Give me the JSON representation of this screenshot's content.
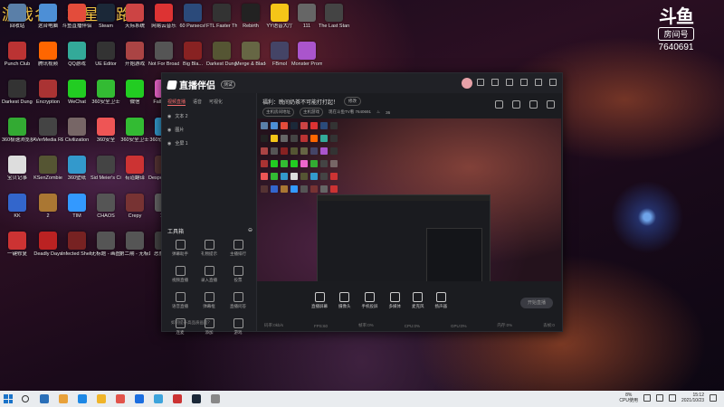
{
  "overlay_title": "游戏名：救星之路",
  "logo": {
    "mark": "斗鱼",
    "sub": "房间号",
    "room": "7640691"
  },
  "desktop_icons": [
    {
      "label": "回收站",
      "color": "#5a7fa8"
    },
    {
      "label": "这台电脑",
      "color": "#4d8fd6"
    },
    {
      "label": "斗鱼直播伴侣",
      "color": "#e34c3b"
    },
    {
      "label": "Steam",
      "color": "#1b2838"
    },
    {
      "label": "天际系统",
      "color": "#c44"
    },
    {
      "label": "网易云音乐",
      "color": "#d33"
    },
    {
      "label": "60 Parsecs!",
      "color": "#2b4a7a"
    },
    {
      "label": "FTL Faster Than Light",
      "color": "#333"
    },
    {
      "label": "Rebirth",
      "color": "#222"
    },
    {
      "label": "YY语音大厅",
      "color": "#f5c518"
    },
    {
      "label": "111",
      "color": "#666"
    },
    {
      "label": "The Last Stand A...",
      "color": "#444"
    },
    {
      "label": "Punch Club",
      "color": "#b33"
    },
    {
      "label": "腾讯视频",
      "color": "#f60"
    },
    {
      "label": "QQ游戏",
      "color": "#3a9"
    },
    {
      "label": "UE Editor",
      "color": "#333"
    },
    {
      "label": "开始游戏",
      "color": "#a44"
    },
    {
      "label": "Not For Broadcast",
      "color": "#555"
    },
    {
      "label": "Big Bla...",
      "color": "#822"
    },
    {
      "label": "Darkest Dungeon",
      "color": "#553"
    },
    {
      "label": "Merge & Blade",
      "color": "#664"
    },
    {
      "label": "FBmol",
      "color": "#446"
    },
    {
      "label": "Monster Prom",
      "color": "#a5c"
    },
    {
      "label": "Darkest Dungeon 2",
      "color": "#333"
    },
    {
      "label": "Encryption",
      "color": "#a33"
    },
    {
      "label": "WeChat",
      "color": "#2c2"
    },
    {
      "label": "360安全卫士",
      "color": "#3b3"
    },
    {
      "label": "微信",
      "color": "#2c2"
    },
    {
      "label": "Fall Guys",
      "color": "#e6c"
    },
    {
      "label": "360极速浏览器",
      "color": "#3a3"
    },
    {
      "label": "AVerMedia RECentral 4",
      "color": "#444"
    },
    {
      "label": "Civilization",
      "color": "#766"
    },
    {
      "label": "360安全",
      "color": "#e55"
    },
    {
      "label": "360安全卫士",
      "color": "#3b3"
    },
    {
      "label": "360软件管家",
      "color": "#39c"
    },
    {
      "label": "宝贝记事",
      "color": "#ddd"
    },
    {
      "label": "KSenZombie",
      "color": "#553"
    },
    {
      "label": "360壁纸",
      "color": "#39c"
    },
    {
      "label": "Sid Meier's Civilization",
      "color": "#444"
    },
    {
      "label": "有道翻译",
      "color": "#c33"
    },
    {
      "label": "Despot's Game",
      "color": "#533"
    },
    {
      "label": "KK",
      "color": "#36c"
    },
    {
      "label": "2",
      "color": "#a73"
    },
    {
      "label": "TIM",
      "color": "#39f"
    },
    {
      "label": "CHAOS",
      "color": "#555"
    },
    {
      "label": "Crepy",
      "color": "#733"
    },
    {
      "label": "111",
      "color": "#666"
    },
    {
      "label": "一键修复",
      "color": "#c33"
    },
    {
      "label": "Deadly Days",
      "color": "#b22"
    },
    {
      "label": "Infected Shelter",
      "color": "#722"
    },
    {
      "label": "无标题 - 画图",
      "color": "#555"
    },
    {
      "label": "第二期 - 无标题",
      "color": "#555"
    },
    {
      "label": "恶魔之路",
      "color": "#444"
    }
  ],
  "app": {
    "name": "直播伴侣",
    "version_badge": "测试",
    "tabs": [
      "视频直播",
      "语音",
      "可视化"
    ],
    "scenes": [
      "文本 2",
      "图片",
      "全屏 1"
    ],
    "announcement": "福利：晚间奶茶不可能打打起！",
    "announce_button": "修改",
    "room_label": "主机房间地址",
    "room_type": "主机游戏",
    "room_sub": "现在斗鱼TV看 7640691",
    "viewers": "36",
    "tools_title": "工具箱",
    "tools": [
      "弹幕助手",
      "礼物提示",
      "主播排行",
      "视频直播",
      "录入直播",
      "投票",
      "语音直播",
      "弹幕框",
      "直播问答",
      "连麦",
      "添加",
      "游戏"
    ],
    "controls": [
      "直播屏幕",
      "摄像头",
      "手机投屏",
      "多媒体",
      "麦克风",
      "扬声器"
    ],
    "start_button": "开始直播",
    "footer_left": "如何提升高品质画面？",
    "status": [
      "码率:0kb/s",
      "FPS:60",
      "帧率:0%",
      "CPU:0%",
      "GPU:0%",
      "内存:0%",
      "丢帧:0"
    ]
  },
  "taskbar": {
    "apps": [
      "#2b6fb8",
      "#e8a13a",
      "#1e88e5",
      "#f0b429",
      "#e2534b",
      "#1b6ee0",
      "#3da4dc",
      "#c33",
      "#1b2838",
      "#888"
    ],
    "cpu_label": "CPU使用",
    "cpu_value": "8%",
    "time": "15:12",
    "date": "2021/10/23"
  }
}
